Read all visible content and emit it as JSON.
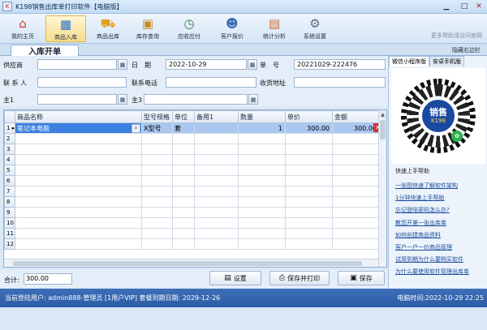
{
  "window": {
    "title": "K198销售出库单打印软件【电脑版】",
    "app_icon_text": "K"
  },
  "toolbar": {
    "items": [
      {
        "label": "我的主页",
        "icon": "home-icon"
      },
      {
        "label": "商品入库",
        "icon": "goods-in-icon"
      },
      {
        "label": "商品出库",
        "icon": "truck-icon"
      },
      {
        "label": "库存查询",
        "icon": "stock-box-icon"
      },
      {
        "label": "应收应付",
        "icon": "clock-icon"
      },
      {
        "label": "客户报价",
        "icon": "customer-icon"
      },
      {
        "label": "统计分析",
        "icon": "chart-icon"
      },
      {
        "label": "系统设置",
        "icon": "gear-icon"
      }
    ],
    "hint": "更多帮助请访问官网"
  },
  "tabs": {
    "active": "入库开单",
    "hide_right": "隐藏右边栏"
  },
  "form": {
    "supplier_label": "供应商",
    "supplier_value": "",
    "date_label": "日　期",
    "date_value": "2022-10-29",
    "number_label": "单　号",
    "number_value": "20221029-222476",
    "contact_label": "联 系 人",
    "contact_value": "",
    "phone_label": "联系电话",
    "phone_value": "",
    "address_label": "收货地址",
    "address_value": "",
    "main1_label": "主1",
    "main1_value": "",
    "main3_label": "主3",
    "main3_value": ""
  },
  "grid": {
    "columns": [
      "商品名称",
      "型号规格",
      "单位",
      "备用1",
      "数量",
      "单价",
      "金额"
    ],
    "rows": [
      {
        "num": "1",
        "name": "笔记本电脑",
        "model": "X型号",
        "unit": "套",
        "spare": "",
        "qty": "1",
        "price": "300.00",
        "amount": "300.00"
      }
    ],
    "row_numbers": [
      "2",
      "3",
      "4",
      "5",
      "6",
      "7",
      "8",
      "9",
      "10",
      "11",
      "12"
    ]
  },
  "bottom": {
    "total_label": "合计:",
    "total_value": "300.00",
    "settings_label": "设置",
    "save_print_label": "保存并打印",
    "save_label": "保存"
  },
  "right_panel": {
    "tabs": [
      "微信小程序版",
      "安卓手机版"
    ],
    "qr_text_main": "销售",
    "qr_text_sub": "K198",
    "help_title": "快速上手帮助",
    "links": [
      "一张图快速了解软件架构",
      "1分钟快速上手帮助",
      "忘记登陆密码怎么办?",
      "教您开第一张出库单",
      "如何创建商品资料",
      "客户一户一价商品管理",
      "试用到期为什么要购买软件",
      "为什么要使用软件管理出库单"
    ]
  },
  "status": {
    "left": "当前登陆用户: admin888-管理员 [1用户VIP] 套餐到期日期: 2029-12-26",
    "right": "电脑时间:2022-10-29 22:25"
  },
  "colors": {
    "accent": "#2d5ca6",
    "selection": "#3b7fe0",
    "row_highlight": "#a9c7f0"
  }
}
